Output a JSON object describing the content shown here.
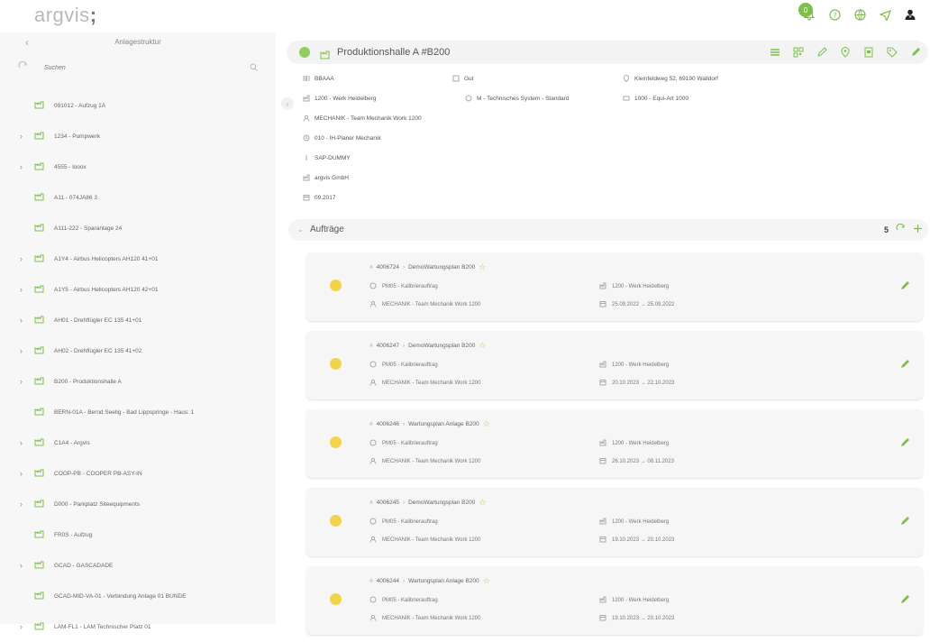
{
  "app": {
    "logo_light": "argvis",
    "logo_bold": ";"
  },
  "topbar": {
    "notification_count": "0"
  },
  "sidebar": {
    "title": "Anlagestruktur",
    "search_placeholder": "Suchen",
    "items": [
      {
        "label": "091012 - Aufzug 1A",
        "expandable": false
      },
      {
        "label": "1234 - Pumpwerk",
        "expandable": true
      },
      {
        "label": "4555 - looox",
        "expandable": true
      },
      {
        "label": "A11 - 074JA86 3",
        "expandable": false
      },
      {
        "label": "A111-222 - Sparanlage 24",
        "expandable": false
      },
      {
        "label": "A1Y4 - Airbus Helicopters AH120 41+01",
        "expandable": true
      },
      {
        "label": "A1Y5 - Airbus Helicopters AH120 42+01",
        "expandable": true
      },
      {
        "label": "AH01 - Drehflügler EC 135 41+01",
        "expandable": true
      },
      {
        "label": "AH02 - Drehflügler EC 135 41+02",
        "expandable": true
      },
      {
        "label": "B200 - Produktionshalle A",
        "expandable": true
      },
      {
        "label": "BERN-01A - Bernd Seelig - Bad Lippspringe - Haus: 1",
        "expandable": false
      },
      {
        "label": "C1A4 - Argvis",
        "expandable": true
      },
      {
        "label": "COOP-PB - COOPER PB-ASY-IN",
        "expandable": true
      },
      {
        "label": "D000 - Parkplatz Siteequipments",
        "expandable": true
      },
      {
        "label": "FR0S - Aufzug",
        "expandable": false
      },
      {
        "label": "GCAD - GASCADADE",
        "expandable": true
      },
      {
        "label": "GCAD-MID-VA-01 - Verbindung Anlage 01 BUNDE",
        "expandable": false
      },
      {
        "label": "LAM-FL1 - LAM Technischer Platz 01",
        "expandable": true
      }
    ]
  },
  "object": {
    "title": "Produktionshalle A #B200",
    "status_color": "#93cc64",
    "attributes": {
      "code": "BBAAA",
      "condition": "Gut",
      "address": "Kleinfeldweg 52, 69190 Walldorf",
      "plant": "1200 - Werk Heidelberg",
      "system": "M - Technisches System - Standard",
      "equi_art": "1000 - Equi-Art 1000",
      "team": "MECHANIK - Team Mechanik Work 1200",
      "planner": "010 - IH-Planer Mechanik",
      "dummy": "SAP-DUMMY",
      "company": "argvis GmbH",
      "date": "09.2017"
    }
  },
  "orders_section": {
    "title": "Aufträge",
    "count": "5"
  },
  "orders": [
    {
      "number": "4006724",
      "plan": "DemoWartungsplan B200",
      "type": "PM05 - Kalibrierauftrag",
      "plant": "1200 - Werk Heidelberg",
      "team": "MECHANIK - Team Mechanik Work 1200",
      "dates": "25.09.2022 → 25.09.2022"
    },
    {
      "number": "4006247",
      "plan": "DemoWartungsplan B200",
      "type": "PM05 - Kalibrierauftrag",
      "plant": "1200 - Werk Heidelberg",
      "team": "MECHANIK - Team Mechanik Work 1200",
      "dates": "20.10.2023 → 22.10.2023"
    },
    {
      "number": "4006246",
      "plan": "Wartungsplan Anlage B200",
      "type": "PM05 - Kalibrierauftrag",
      "plant": "1200 - Werk Heidelberg",
      "team": "MECHANIK - Team Mechanik Work 1200",
      "dates": "26.10.2023 → 08.11.2023"
    },
    {
      "number": "4006245",
      "plan": "DemoWartungsplan B200",
      "type": "PM05 - Kalibrierauftrag",
      "plant": "1200 - Werk Heidelberg",
      "team": "MECHANIK - Team Mechanik Work 1200",
      "dates": "19.10.2023 → 20.10.2023"
    },
    {
      "number": "4006244",
      "plan": "Wartungsplan Anlage B200",
      "type": "PM05 - Kalibrierauftrag",
      "plant": "1200 - Werk Heidelberg",
      "team": "MECHANIK - Team Mechanik Work 1200",
      "dates": "19.10.2023 → 20.10.2023"
    }
  ],
  "colors": {
    "accent_green": "#7cc04a",
    "status_yellow": "#f2d34c"
  }
}
